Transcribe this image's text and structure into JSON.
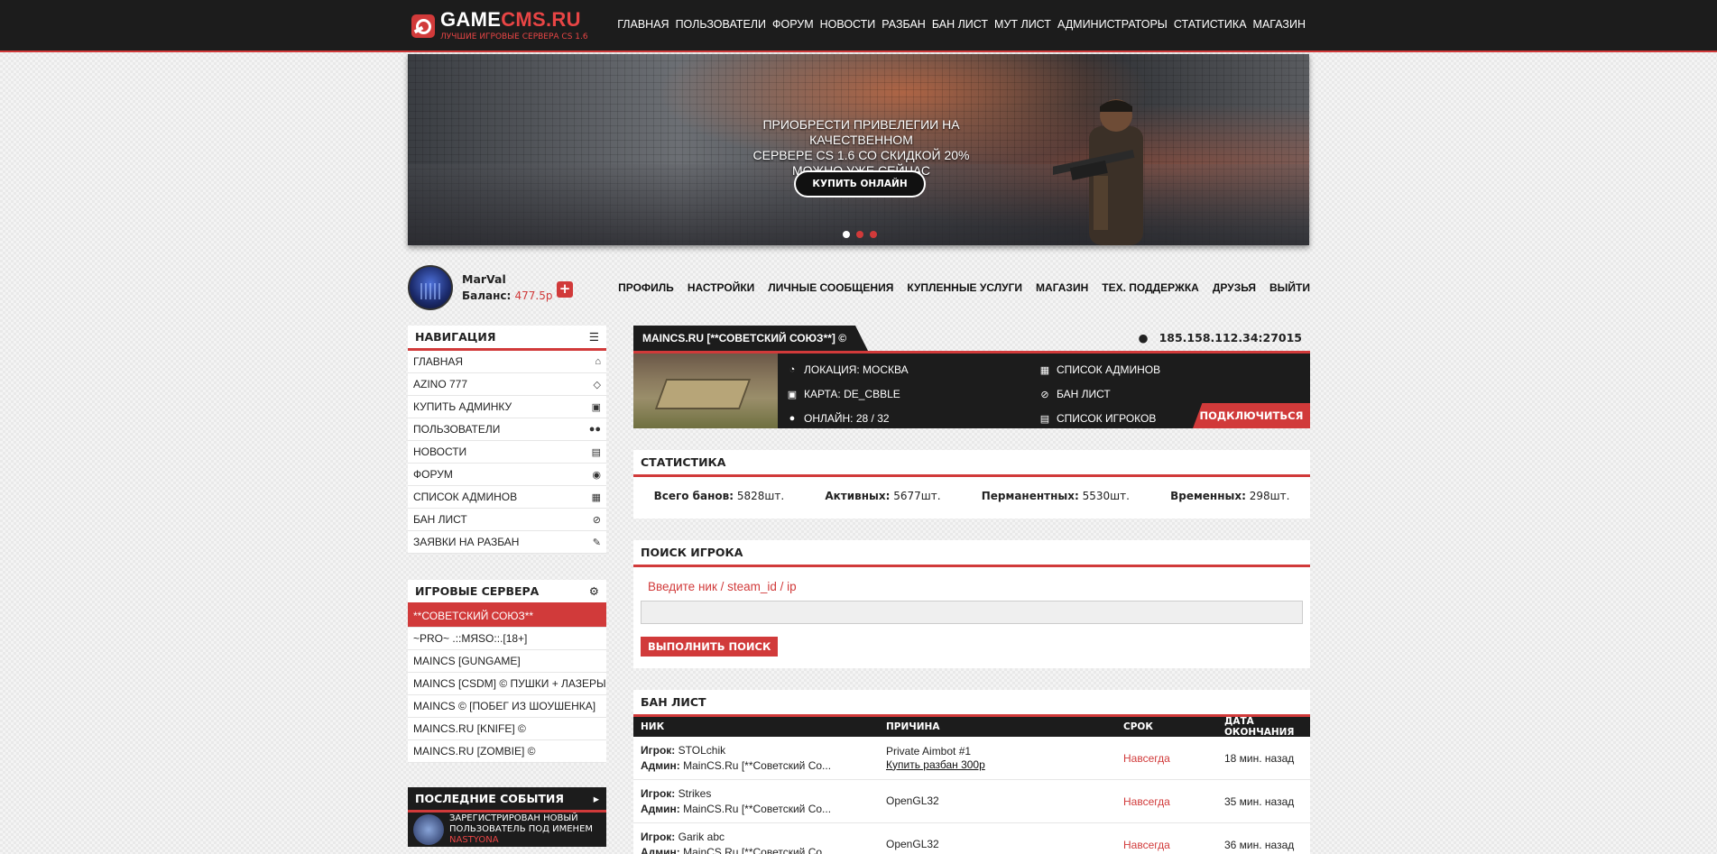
{
  "header": {
    "logo_main": "GAME",
    "logo_accent": "CMS.RU",
    "logo_sub": "ЛУЧШИЕ ИГРОВЫЕ СЕРВЕРА CS 1.6",
    "nav": [
      "ГЛАВНАЯ",
      "ПОЛЬЗОВАТЕЛИ",
      "ФОРУМ",
      "НОВОСТИ",
      "РАЗБАН",
      "БАН ЛИСТ",
      "МУТ ЛИСТ",
      "АДМИНИСТРАТОРЫ",
      "СТАТИСТИКА",
      "МАГАЗИН"
    ]
  },
  "banner": {
    "line1": "ПРИОБРЕСТИ ПРИВЕЛЕГИИ НА КАЧЕСТВЕННОМ",
    "line2": "СЕРВЕРЕ CS 1.6 СО СКИДКОЙ 20%",
    "line3": "МОЖНО УЖЕ СЕЙЧАС",
    "button": "КУПИТЬ ОНЛАЙН",
    "slides": 3,
    "active_slide": 1
  },
  "user": {
    "name": "MarVal",
    "balance_label": "Баланс:",
    "balance_value": "477.5р",
    "plus": "+",
    "nav": [
      "ПРОФИЛЬ",
      "НАСТРОЙКИ",
      "ЛИЧНЫЕ СООБЩЕНИЯ",
      "КУПЛЕННЫЕ УСЛУГИ",
      "МАГАЗИН",
      "ТЕХ. ПОДДЕРЖКА",
      "ДРУЗЬЯ",
      "ВЫЙТИ"
    ]
  },
  "sidebar": {
    "nav_title": "НАВИГАЦИЯ",
    "nav_items": [
      {
        "label": "ГЛАВНАЯ",
        "icon": "home-icon"
      },
      {
        "label": "AZINO 777",
        "icon": "diamond-icon"
      },
      {
        "label": "КУПИТЬ АДМИНКУ",
        "icon": "cart-icon"
      },
      {
        "label": "ПОЛЬЗОВАТЕЛИ",
        "icon": "users-icon"
      },
      {
        "label": "НОВОСТИ",
        "icon": "newspaper-icon"
      },
      {
        "label": "ФОРУМ",
        "icon": "chat-icon"
      },
      {
        "label": "СПИСОК АДМИНОВ",
        "icon": "id-card-icon"
      },
      {
        "label": "БАН ЛИСТ",
        "icon": "ban-icon"
      },
      {
        "label": "ЗАЯВКИ НА РАЗБАН",
        "icon": "edit-icon"
      }
    ],
    "servers_title": "ИГРОВЫЕ СЕРВЕРА",
    "servers": [
      "**СОВЕТСКИЙ СОЮЗ**",
      "~PRO~ .::МЯSO::.[18+]",
      "MAINCS [GUNGAME]",
      "MAINCS [CSDM] © ПУШКИ + ЛАЗЕРЫ",
      "MAINCS © [ПОБЕГ ИЗ ШОУШЕНКА]",
      "MAINCS.RU [KNIFE] ©",
      "MAINCS.RU [ZOMBIE] ©"
    ],
    "events_title": "ПОСЛЕДНИЕ СОБЫТИЯ",
    "event_text": "ЗАРЕГИСТРИРОВАН НОВЫЙ ПОЛЬЗОВАТЕЛЬ ПОД ИМЕНЕМ",
    "event_nick": "NASTYONA"
  },
  "server": {
    "title": "MAINCS.RU [**СОВЕТСКИЙ СОЮЗ**] ©",
    "ip": "185.158.112.34:27015",
    "location": "ЛОКАЦИЯ: МОСКВА",
    "map": "КАРТА: DE_CBBLE",
    "online": "ОНЛАЙН: 28 / 32",
    "admins": "СПИСОК АДМИНОВ",
    "banlist": "БАН ЛИСТ",
    "players": "СПИСОК ИГРОКОВ",
    "connect": "ПОДКЛЮЧИТЬСЯ"
  },
  "stats": {
    "title": "СТАТИСТИКА",
    "items": [
      {
        "label": "Всего банов:",
        "value": "5828шт."
      },
      {
        "label": "Активных:",
        "value": "5677шт."
      },
      {
        "label": "Перманентных:",
        "value": "5530шт."
      },
      {
        "label": "Временных:",
        "value": "298шт."
      }
    ]
  },
  "search": {
    "title": "ПОИСК ИГРОКА",
    "label": "Введите ник / steam_id / ip",
    "button": "ВЫПОЛНИТЬ ПОИСК"
  },
  "bans": {
    "title": "БАН ЛИСТ",
    "columns": [
      "НИК",
      "ПРИЧИНА",
      "СРОК",
      "ДАТА ОКОНЧАНИЯ"
    ],
    "player_label": "Игрок:",
    "admin_label": "Админ:",
    "rows": [
      {
        "player": "STOLchik",
        "admin": "MainCS.Ru [**Советский Со...",
        "reason": "Private Aimbot #1",
        "link": "Купить разбан 300р",
        "term": "Навсегда",
        "end": "18 мин. назад"
      },
      {
        "player": "Strikes",
        "admin": "MainCS.Ru [**Советский Со...",
        "reason": "OpenGL32",
        "link": "",
        "term": "Навсегда",
        "end": "35 мин. назад"
      },
      {
        "player": "Garik abc",
        "admin": "MainCS.Ru [**Советский Со...",
        "reason": "OpenGL32",
        "link": "",
        "term": "Навсегда",
        "end": "36 мин. назад"
      }
    ]
  }
}
